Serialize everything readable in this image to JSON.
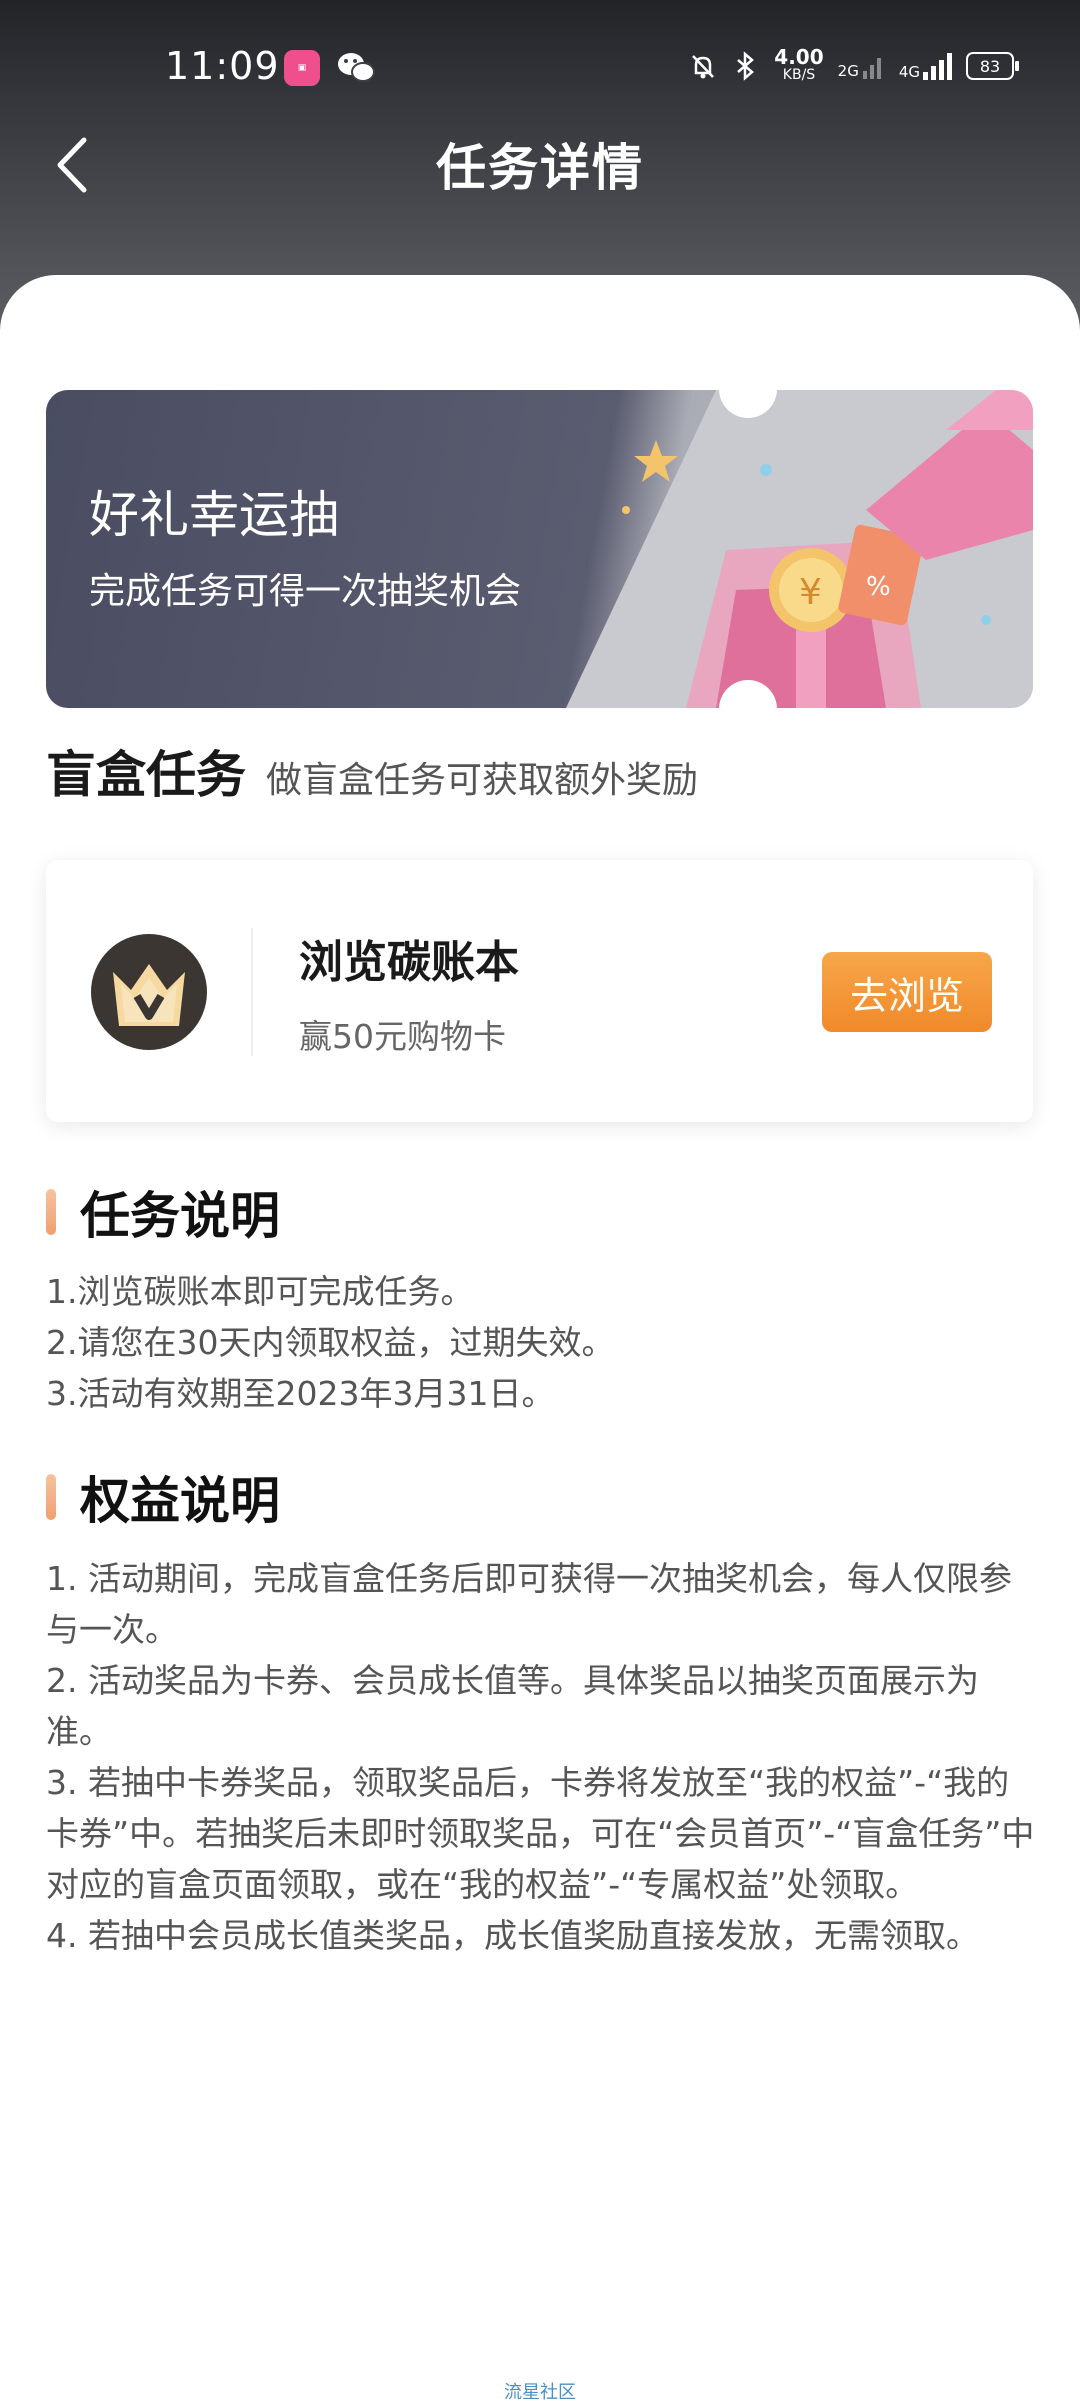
{
  "status_bar": {
    "time": "11:09",
    "net_speed_value": "4.00",
    "net_speed_unit": "KB/S",
    "sim1": "2G",
    "sim2": "4G",
    "battery": "83"
  },
  "header": {
    "title": "任务详情"
  },
  "banner": {
    "title": "好礼幸运抽",
    "subtitle": "完成任务可得一次抽奖机会"
  },
  "blind_box": {
    "title": "盲盒任务",
    "subtitle": "做盲盒任务可获取额外奖励"
  },
  "task": {
    "name": "浏览碳账本",
    "reward": "赢50元购物卡",
    "button_label": "去浏览"
  },
  "task_info": {
    "title": "任务说明",
    "lines": [
      "1.浏览碳账本即可完成任务。",
      "2.请您在30天内领取权益，过期失效。",
      "3.活动有效期至2023年3月31日。"
    ]
  },
  "benefit_info": {
    "title": "权益说明",
    "lines": [
      "1. 活动期间，完成盲盒任务后即可获得一次抽奖机会，每人仅限参与一次。",
      "2. 活动奖品为卡券、会员成长值等。具体奖品以抽奖页面展示为准。",
      "3. 若抽中卡券奖品，领取奖品后，卡券将发放至“我的权益”-“我的卡券”中。若抽奖后未即时领取奖品，可在“会员首页”-“盲盒任务”中对应的盲盒页面领取，或在“我的权益”-“专属权益”处领取。",
      "4. 若抽中会员成长值类奖品，成长值奖励直接发放，无需领取。"
    ]
  },
  "footer": {
    "label": "流星社区"
  }
}
